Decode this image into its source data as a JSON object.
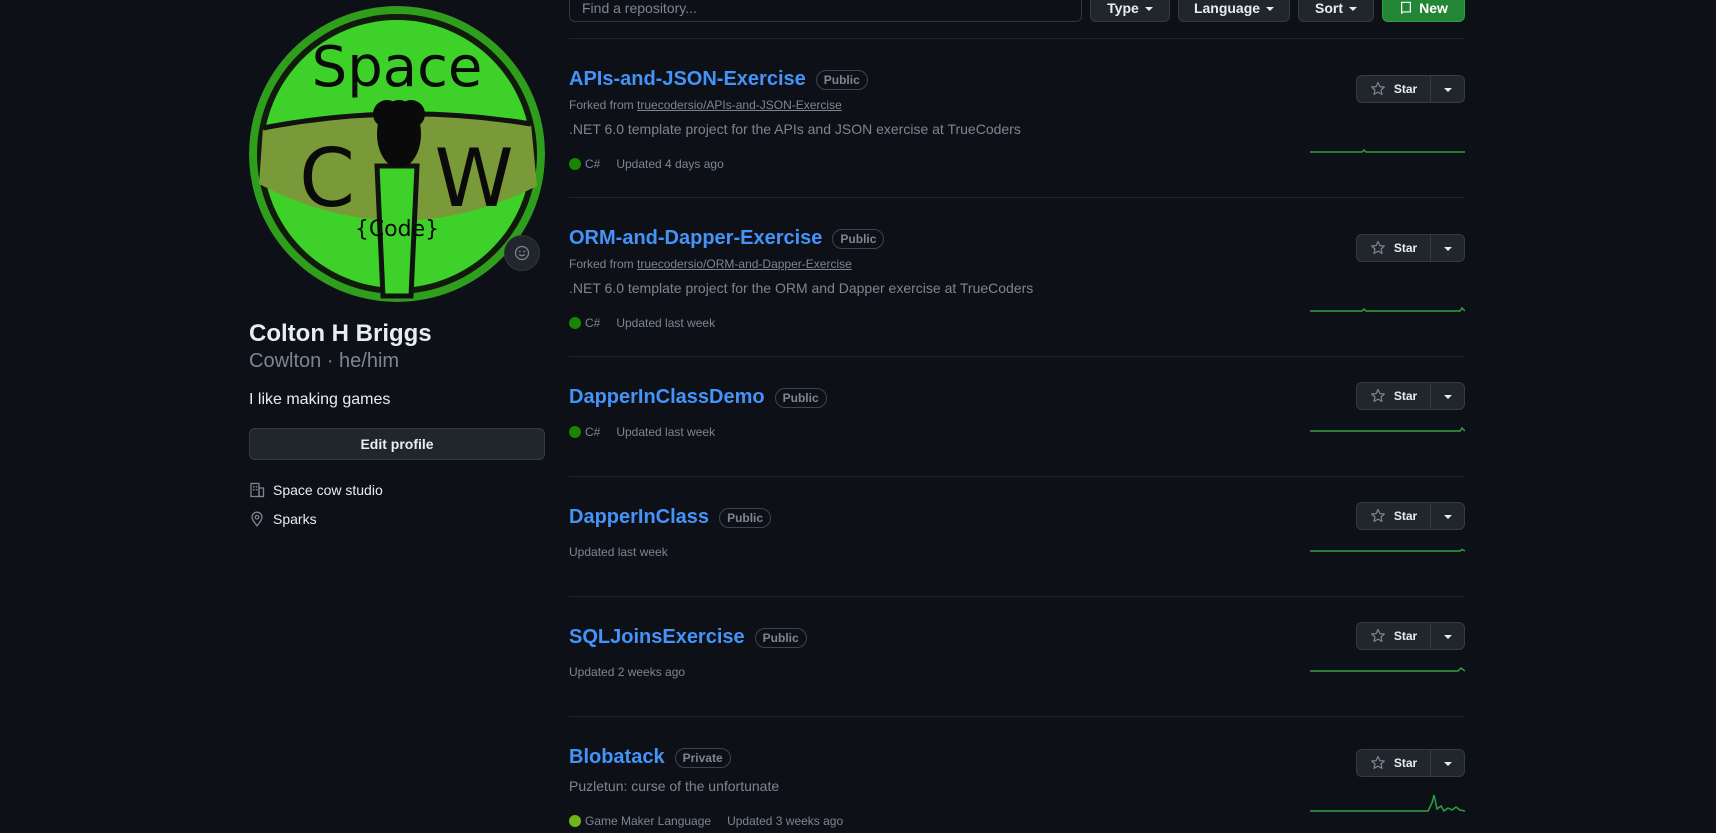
{
  "profile": {
    "name": "Colton H Briggs",
    "handle": "Cowlton · he/him",
    "bio": "I like making games",
    "edit_label": "Edit profile",
    "company": "Space cow studio",
    "location": "Sparks",
    "avatar_text": {
      "line1": "Space",
      "c": "C",
      "w": "W",
      "code": "{Code}"
    }
  },
  "filters": {
    "search_placeholder": "Find a repository...",
    "type_label": "Type",
    "language_label": "Language",
    "sort_label": "Sort",
    "new_label": "New"
  },
  "star_label": "Star",
  "colors": {
    "accent": "#4493f8",
    "csharp": "#178600",
    "gml": "#71b417",
    "spark": "#2ea043",
    "new": "#238636"
  },
  "repos": [
    {
      "name": "APIs-and-JSON-Exercise",
      "visibility": "Public",
      "forked_prefix": "Forked from",
      "forked_from": "truecodersio/APIs-and-JSON-Exercise",
      "description": ".NET 6.0 template project for the APIs and JSON exercise at TrueCoders",
      "language": "C#",
      "updated": "Updated 4 days ago"
    },
    {
      "name": "ORM-and-Dapper-Exercise",
      "visibility": "Public",
      "forked_prefix": "Forked from",
      "forked_from": "truecodersio/ORM-and-Dapper-Exercise",
      "description": ".NET 6.0 template project for the ORM and Dapper exercise at TrueCoders",
      "language": "C#",
      "updated": "Updated last week"
    },
    {
      "name": "DapperInClassDemo",
      "visibility": "Public",
      "language": "C#",
      "updated": "Updated last week"
    },
    {
      "name": "DapperInClass",
      "visibility": "Public",
      "updated": "Updated last week"
    },
    {
      "name": "SQLJoinsExercise",
      "visibility": "Public",
      "updated": "Updated 2 weeks ago"
    },
    {
      "name": "Blobatack",
      "visibility": "Private",
      "description": "Puzletun: curse of the unfortunate",
      "language": "Game Maker Language",
      "updated": "Updated 3 weeks ago"
    }
  ]
}
